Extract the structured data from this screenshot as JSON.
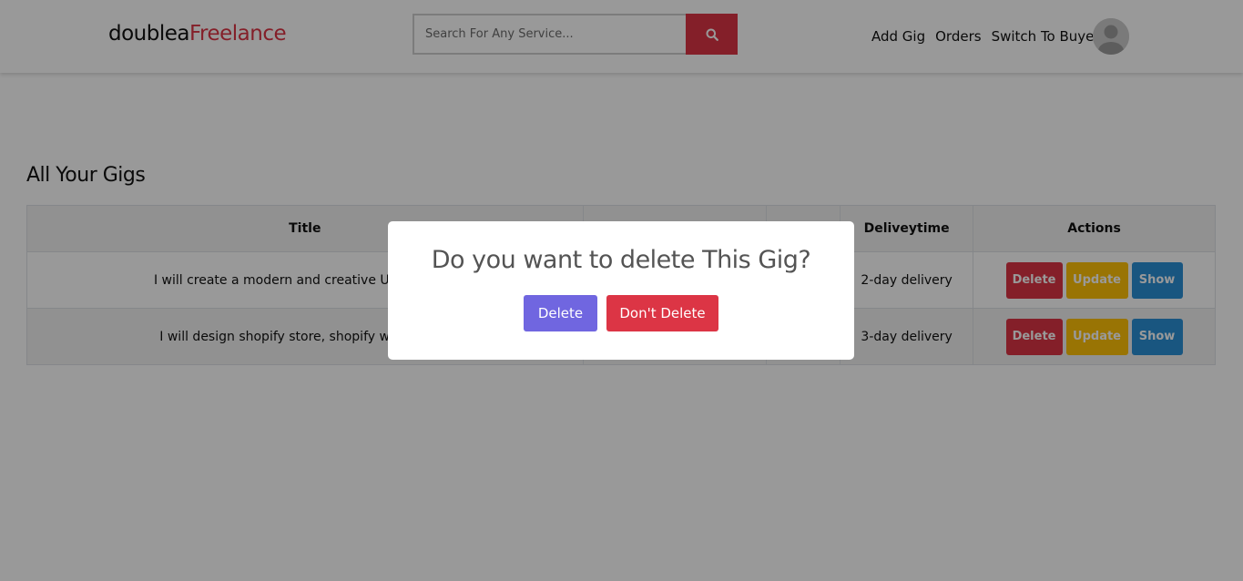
{
  "brand": {
    "prefix": "doublea",
    "accent": "Freelance",
    "accent_color": "#dc3545"
  },
  "search": {
    "placeholder": "Search For Any Service...",
    "icon": "search-icon"
  },
  "nav": {
    "add_gig": "Add Gig",
    "orders": "Orders",
    "switch": "Switch To Buyer",
    "avatar_icon": "user-avatar-icon"
  },
  "main": {
    "heading": "All Your Gigs",
    "columns": [
      "Title",
      "",
      "",
      "Deliveytime",
      "Actions"
    ],
    "rows": [
      {
        "title": "I will create a modern and creative UI design fo",
        "delivery": "2-day delivery",
        "delete": "Delete",
        "update": "Update",
        "show": "Show"
      },
      {
        "title": "I will design shopify store, shopify website, dr",
        "delivery": "3-day delivery",
        "delete": "Delete",
        "update": "Update",
        "show": "Show"
      }
    ]
  },
  "modal": {
    "title": "Do you want to delete This Gig?",
    "confirm": "Delete",
    "cancel": "Don't Delete",
    "confirm_color": "#7066e0",
    "cancel_color": "#dc3545"
  },
  "colors": {
    "danger": "#dc3545",
    "warning": "#ffc107",
    "info": "#2a8fd6",
    "overlay": "rgba(0,0,0,0.4)"
  }
}
